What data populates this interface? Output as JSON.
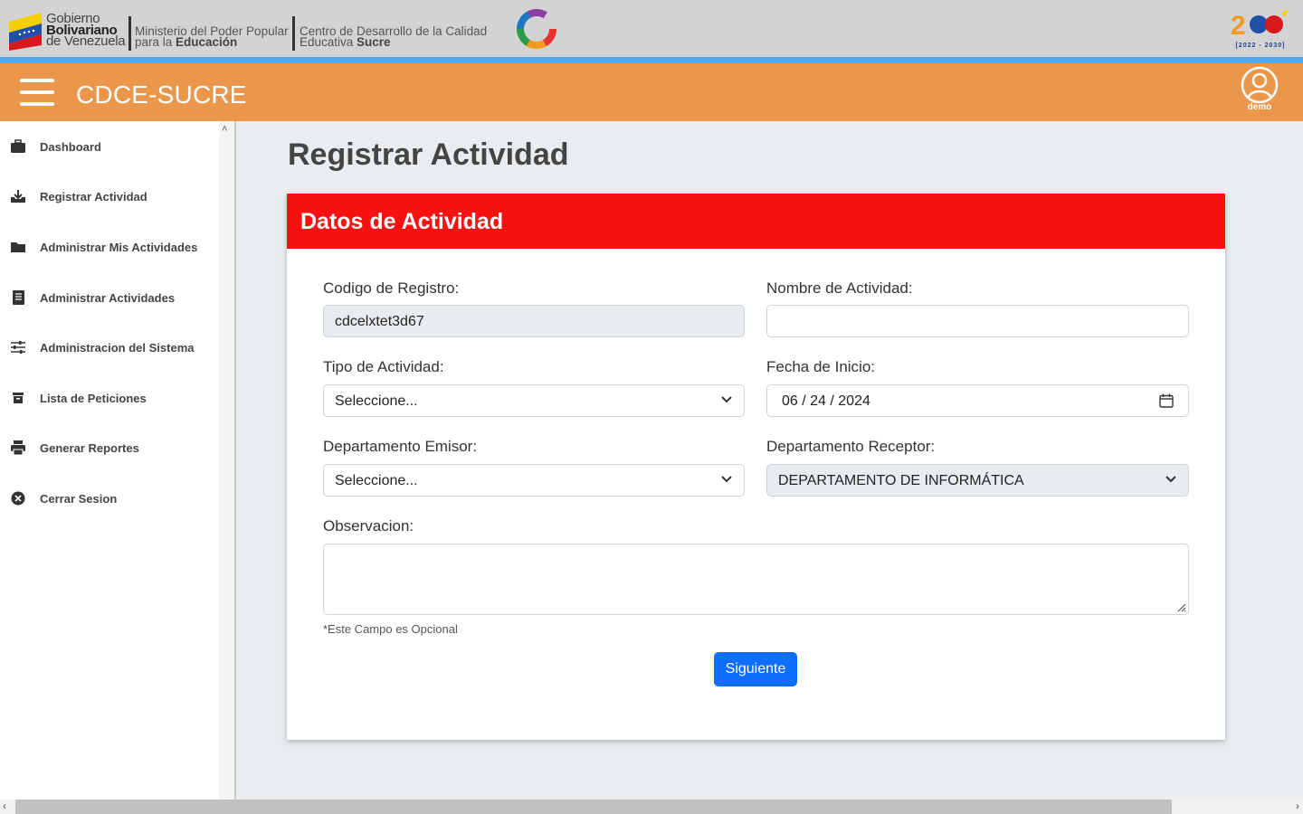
{
  "gov_banner": {
    "gov_line1": "Gobierno",
    "gov_line2": "Bolivariano",
    "gov_line3": "de Venezuela",
    "ministry_line1": "Ministerio del Poder Popular",
    "ministry_line2_a": "para la ",
    "ministry_line2_b": "Educación",
    "center_line1": "Centro de Desarrollo de la Calidad",
    "center_line2_a": "Educativa ",
    "center_line2_b": "Sucre",
    "bicentenario_years": "[2022 - 2030]"
  },
  "header": {
    "app_title": "CDCE-SUCRE",
    "user_name": "demo",
    "colors": {
      "header_bg": "#ea974b",
      "accent_line": "#57a8e6"
    }
  },
  "sidebar": {
    "items": [
      {
        "label": "Dashboard",
        "icon": "briefcase-icon"
      },
      {
        "label": "Registrar Actividad",
        "icon": "download-tray-icon"
      },
      {
        "label": "Administrar Mis Actividades",
        "icon": "folder-icon"
      },
      {
        "label": "Administrar Actividades",
        "icon": "document-list-icon"
      },
      {
        "label": "Administracion del Sistema",
        "icon": "sliders-icon"
      },
      {
        "label": "Lista de Peticiones",
        "icon": "archive-icon"
      },
      {
        "label": "Generar Reportes",
        "icon": "printer-icon"
      },
      {
        "label": "Cerrar Sesion",
        "icon": "close-circle-icon"
      }
    ]
  },
  "main": {
    "page_title": "Registrar Actividad",
    "card_title": "Datos de Actividad",
    "fields": {
      "codigo_label": "Codigo de Registro:",
      "codigo_value": "cdcelxtet3d67",
      "nombre_label": "Nombre de Actividad:",
      "nombre_value": "",
      "tipo_label": "Tipo de Actividad:",
      "tipo_value": "Seleccione...",
      "fecha_label": "Fecha de Inicio:",
      "fecha_value": "06 / 24 / 2024",
      "emisor_label": "Departamento Emisor:",
      "emisor_value": "Seleccione...",
      "receptor_label": "Departamento Receptor:",
      "receptor_value": "DEPARTAMENTO DE INFORMÁTICA",
      "observacion_label": "Observacion:",
      "observacion_hint": "*Este Campo es Opcional"
    },
    "next_button": "Siguiente",
    "colors": {
      "card_header_bg": "#f81111",
      "button_bg": "#0d6efd"
    }
  }
}
